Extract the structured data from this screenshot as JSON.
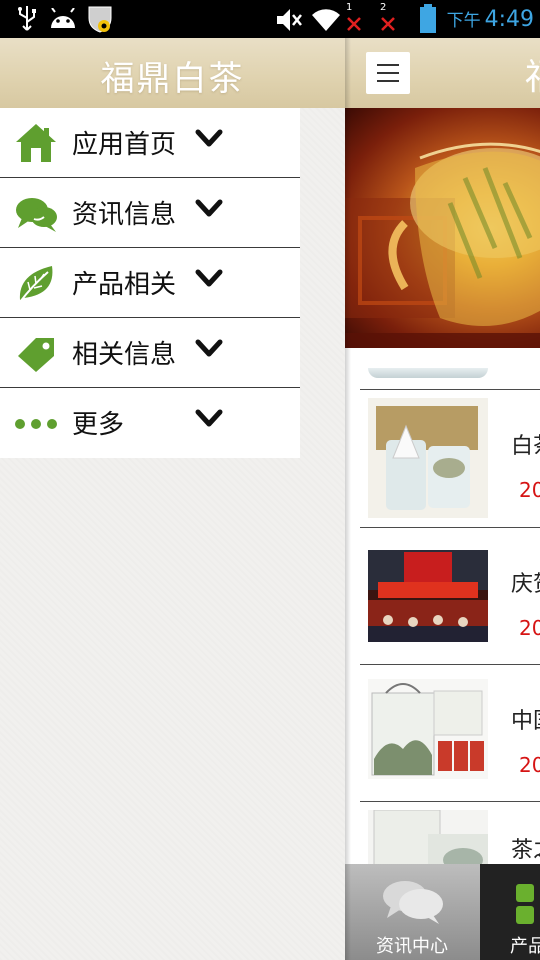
{
  "status_bar": {
    "time_ampm": "下午",
    "time": "4:49",
    "sim1": "1",
    "sim2": "2"
  },
  "drawer": {
    "title": "福鼎白茶",
    "menu_items": [
      {
        "label": "应用首页",
        "icon": "home-icon"
      },
      {
        "label": "资讯信息",
        "icon": "chat-bubbles-icon"
      },
      {
        "label": "产品相关",
        "icon": "leaf-icon"
      },
      {
        "label": "相关信息",
        "icon": "tag-icon"
      },
      {
        "label": "更多",
        "icon": "more-dots-icon"
      }
    ]
  },
  "main": {
    "title_peek": "福",
    "news": [
      {
        "title": "白茶",
        "date": "20"
      },
      {
        "title": "庆贺",
        "date": "20"
      },
      {
        "title": "中国",
        "date": "20"
      },
      {
        "title": "茶之",
        "date": ""
      }
    ],
    "tabs": [
      {
        "label": "资讯中心",
        "icon": "chat-bubbles-icon"
      },
      {
        "label": "产品",
        "icon": "grid-icon"
      }
    ]
  },
  "colors": {
    "accent_green": "#5f9f2f",
    "date_red": "#d61414",
    "time_blue": "#3ea6e3",
    "header_beige": "#e0d3b0"
  }
}
